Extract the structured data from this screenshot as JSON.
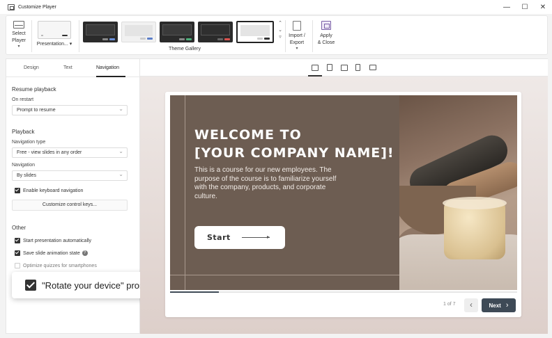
{
  "window": {
    "title": "Customize Player",
    "controls": {
      "minimize": "—",
      "maximize": "☐",
      "close": "✕"
    }
  },
  "ribbon": {
    "select_player": {
      "line1": "Select",
      "line2": "Player",
      "caret": "▾"
    },
    "presentation": {
      "label": "Presentation...",
      "caret": "▾"
    },
    "theme_gallery": {
      "label": "Theme Gallery",
      "scroll_up": "⌃",
      "scroll_down": "⌄",
      "more": "▿"
    },
    "import_export": {
      "line1": "Import /",
      "line2": "Export",
      "caret": "▾"
    },
    "apply_close": {
      "line1": "Apply",
      "line2": "& Close"
    }
  },
  "tabs": [
    {
      "label": "Design"
    },
    {
      "label": "Text"
    },
    {
      "label": "Navigation"
    }
  ],
  "navigation": {
    "resume": {
      "title": "Resume playback",
      "on_restart_label": "On restart",
      "on_restart_value": "Prompt to resume"
    },
    "playback": {
      "title": "Playback",
      "nav_type_label": "Navigation type",
      "nav_type_value": "Free - view slides in any order",
      "navigation_label": "Navigation",
      "navigation_value": "By slides",
      "keyboard_nav": "Enable keyboard navigation",
      "customize_keys": "Customize control keys..."
    },
    "other": {
      "title": "Other",
      "start_auto": "Start presentation automatically",
      "save_anim": "Save slide animation state",
      "optimize": "Optimize quizzes for smartphones"
    }
  },
  "callout": {
    "label": "\"Rotate your device\" prompt",
    "help": "?"
  },
  "slide": {
    "headline_line1": "WELCOME TO",
    "headline_line2": "[YOUR COMPANY NAME]!",
    "body": "This is a course for our new employees. The purpose of the course is to familiarize yourself with the company, products, and corporate culture.",
    "start_label": "Start"
  },
  "player": {
    "progress": 0.14,
    "page_count": "1 of 7",
    "prev": "‹",
    "next_label": "Next",
    "next_chevron": "›"
  },
  "colors": {
    "accent": "#3e4a56",
    "slide_bg": "#6d5d52"
  }
}
